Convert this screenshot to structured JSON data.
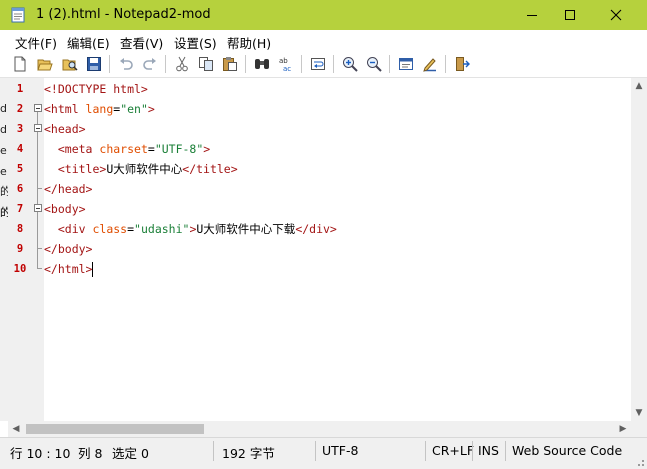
{
  "window": {
    "title": "1 (2).html - Notepad2-mod",
    "accent": "#b6d13d"
  },
  "menu": [
    "文件(F)",
    "编辑(E)",
    "查看(V)",
    "设置(S)",
    "帮助(H)"
  ],
  "left_strip": [
    "d",
    "d",
    "e",
    "e",
    "的",
    "的",
    "的"
  ],
  "editor": {
    "line_numbers": [
      "1",
      "2",
      "3",
      "4",
      "5",
      "6",
      "7",
      "8",
      "9",
      "10"
    ],
    "lines": [
      [
        {
          "t": "<!DOCTYPE html>",
          "c": "tag"
        }
      ],
      [
        {
          "t": "<html ",
          "c": "tag"
        },
        {
          "t": "lang",
          "c": "attr"
        },
        {
          "t": "=",
          "c": "eq"
        },
        {
          "t": "\"en\"",
          "c": "val"
        },
        {
          "t": ">",
          "c": "tag"
        }
      ],
      [
        {
          "t": "<head>",
          "c": "tag"
        }
      ],
      [
        {
          "t": "  "
        },
        {
          "t": "<meta ",
          "c": "tag"
        },
        {
          "t": "charset",
          "c": "attr"
        },
        {
          "t": "=",
          "c": "eq"
        },
        {
          "t": "\"UTF-8\"",
          "c": "val"
        },
        {
          "t": ">",
          "c": "tag"
        }
      ],
      [
        {
          "t": "  "
        },
        {
          "t": "<title>",
          "c": "tag"
        },
        {
          "t": "U大师软件中心"
        },
        {
          "t": "</title>",
          "c": "tag"
        }
      ],
      [
        {
          "t": "</head>",
          "c": "tag"
        }
      ],
      [
        {
          "t": "<body>",
          "c": "tag"
        }
      ],
      [
        {
          "t": "  "
        },
        {
          "t": "<div ",
          "c": "tag"
        },
        {
          "t": "class",
          "c": "attr"
        },
        {
          "t": "=",
          "c": "eq"
        },
        {
          "t": "\"udashi\"",
          "c": "val"
        },
        {
          "t": ">",
          "c": "tag"
        },
        {
          "t": "U大师软件中心下载"
        },
        {
          "t": "</div>",
          "c": "tag"
        }
      ],
      [
        {
          "t": "</body>",
          "c": "tag"
        }
      ],
      [
        {
          "t": "</html>",
          "c": "tag"
        }
      ]
    ]
  },
  "status": {
    "position": "行 10 : 10",
    "column": "列 8",
    "selection": "选定 0",
    "size": "192 字节",
    "encoding": "UTF-8",
    "eol": "CR+LF",
    "mode": "INS",
    "scheme": "Web Source Code"
  },
  "icons": {
    "toolbar": [
      "new-file-icon",
      "open-folder-icon",
      "browse-icon",
      "save-icon",
      "undo-icon",
      "redo-icon",
      "cut-icon",
      "copy-icon",
      "paste-icon",
      "find-icon",
      "replace-icon",
      "wrap-icon",
      "zoom-in-icon",
      "zoom-out-icon",
      "schemes-icon",
      "customize-icon",
      "exit-icon"
    ]
  },
  "colors": {
    "tag": "#a31515",
    "attribute": "#e04d00",
    "value": "#1a7f37",
    "line_number": "#c00000"
  }
}
